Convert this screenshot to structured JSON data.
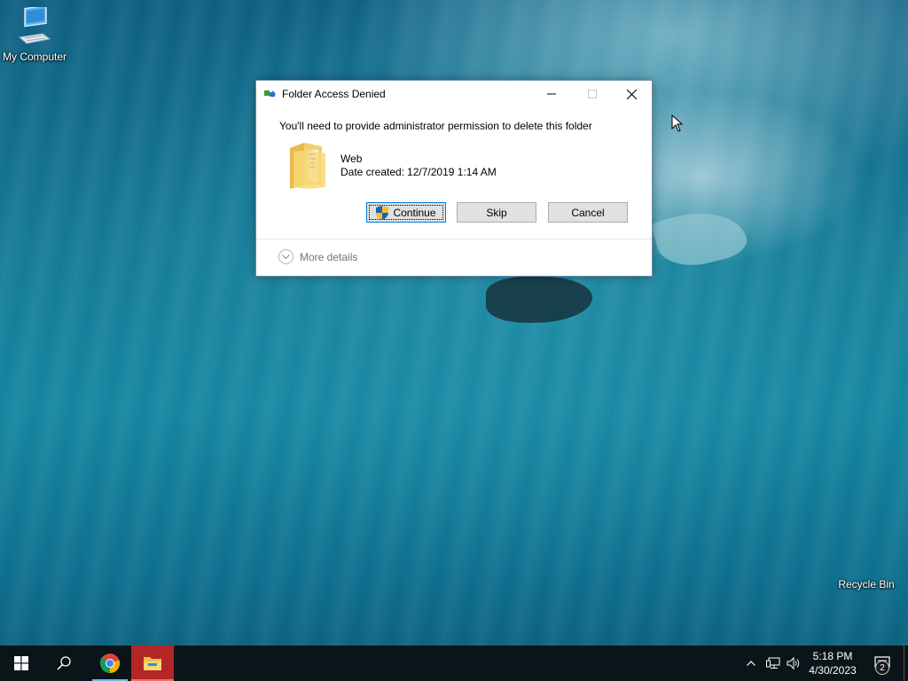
{
  "desktop": {
    "icons": [
      {
        "label": "My Computer",
        "icon": "monitor-icon"
      },
      {
        "label": "Recycle Bin",
        "icon": "recycle-bin-icon"
      }
    ]
  },
  "dialog": {
    "title": "Folder Access Denied",
    "message": "You'll need to provide administrator permission to delete this folder",
    "item_name": "Web",
    "date_label": "Date created:",
    "date_value": "12/7/2019 1:14 AM",
    "buttons": {
      "continue": "Continue",
      "skip": "Skip",
      "cancel": "Cancel"
    },
    "more_details": "More details",
    "caption_buttons": [
      "minimize-icon",
      "maximize-icon",
      "close-icon"
    ]
  },
  "taskbar": {
    "apps": [
      "windows-start-icon",
      "search-icon",
      "chrome-icon",
      "file-explorer-icon"
    ],
    "tray": {
      "time": "5:18 PM",
      "date": "4/30/2023",
      "notification_count": "2"
    }
  },
  "colors": {
    "accent": "#0078d7",
    "explorer_active": "#b32626",
    "taskbar": "#0b1418"
  }
}
